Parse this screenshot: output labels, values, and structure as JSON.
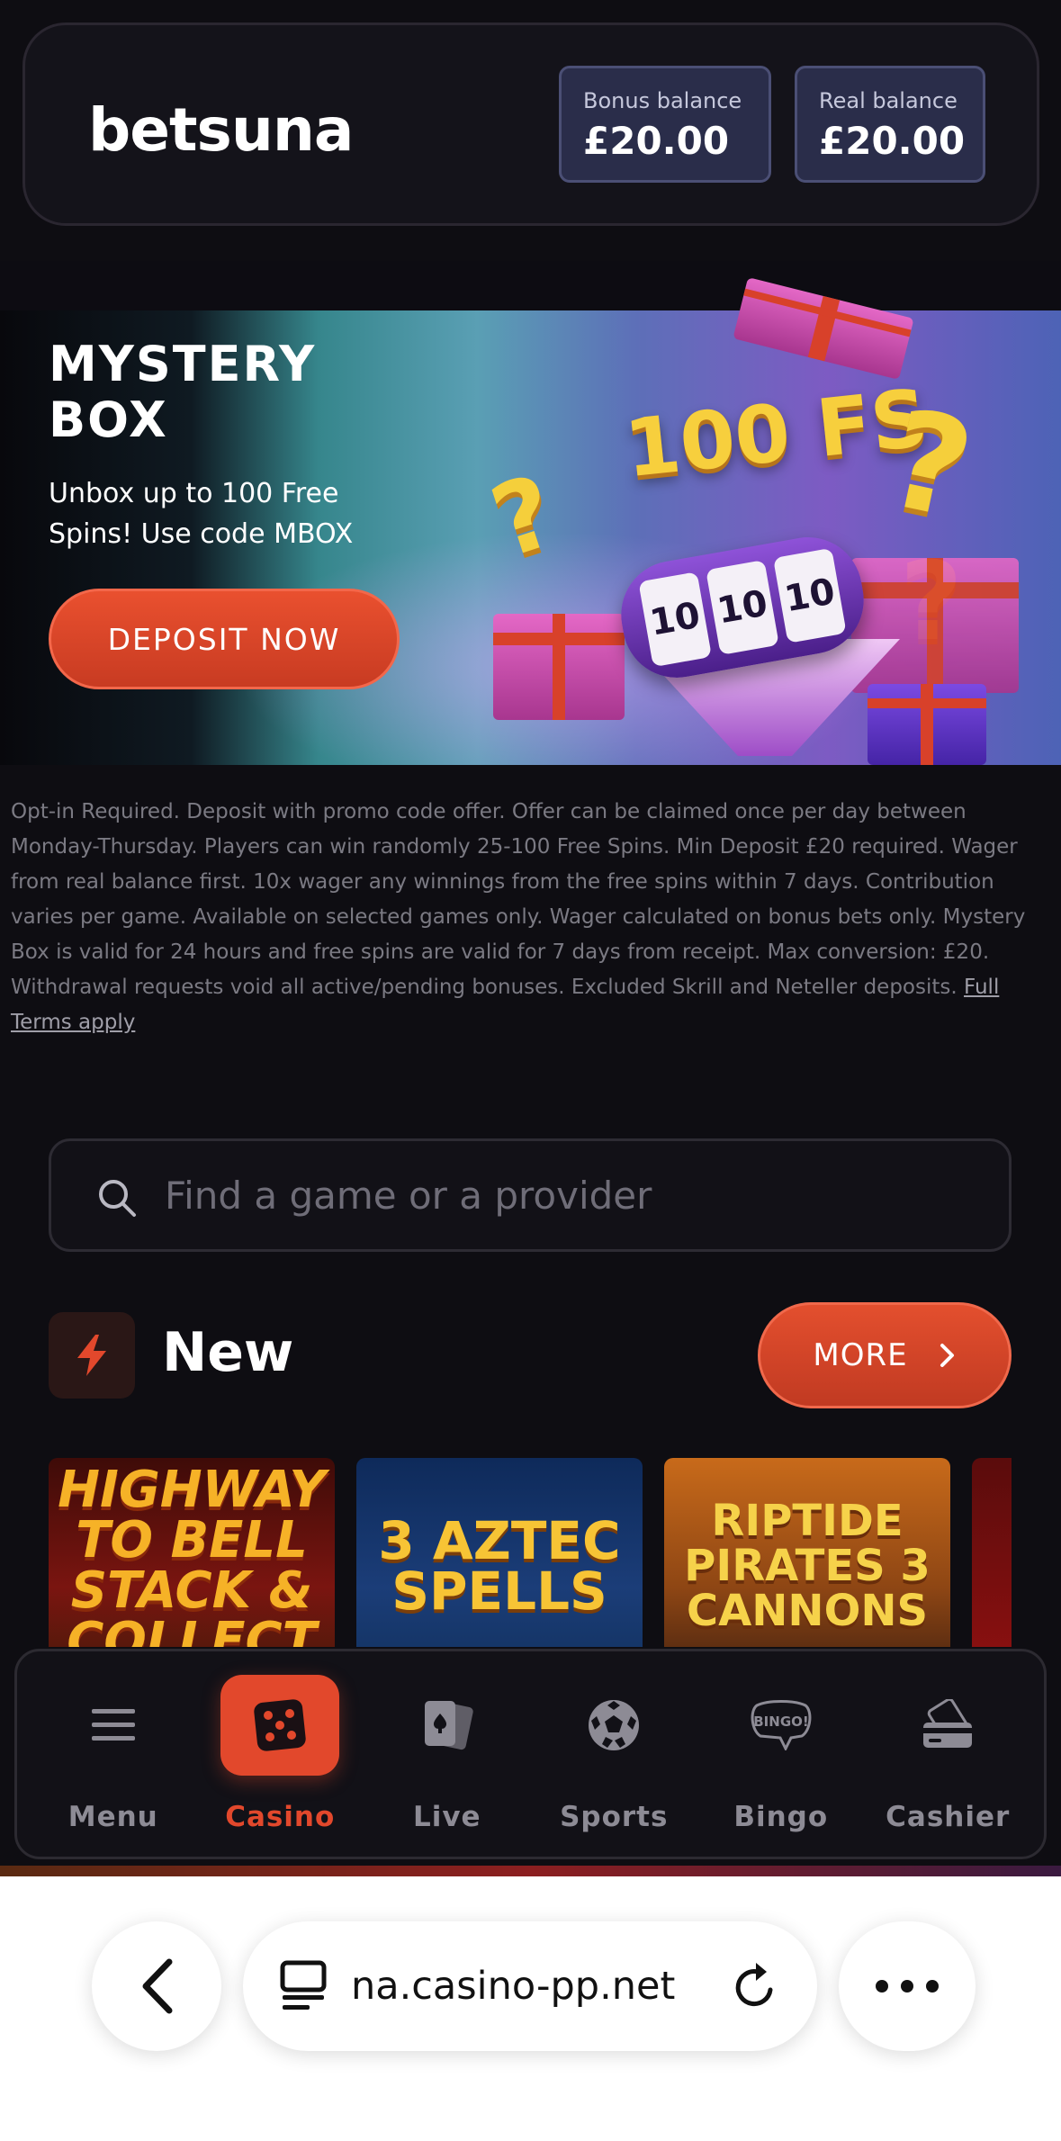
{
  "header": {
    "logo": "betsuna",
    "bonus_balance": {
      "label": "Bonus balance",
      "amount": "£20.00"
    },
    "real_balance": {
      "label": "Real balance",
      "amount": "£20.00"
    }
  },
  "promo": {
    "title": "MYSTERY\nBOX",
    "subtitle": "Unbox up to 100 Free Spins! Use code MBOX",
    "cta": "DEPOSIT NOW",
    "art_text": "100 FS",
    "reels": [
      "10",
      "10",
      "10"
    ],
    "terms": "Opt-in Required. Deposit with promo code offer. Offer can be claimed once per day between Monday-Thursday. Players can win randomly 25-100 Free Spins. Min Deposit £20 required. Wager from real balance first. 10x wager any winnings from the free spins within 7 days. Contribution varies per game. Available on selected games only. Wager calculated on bonus bets only. Mystery Box is valid for 24 hours and free spins are valid for 7 days from receipt. Max conversion: £20. Withdrawal requests void all active/pending bonuses. Excluded Skrill and Neteller deposits.",
    "terms_link": "Full Terms apply"
  },
  "search": {
    "placeholder": "Find a game or a provider",
    "icon": "search-icon"
  },
  "new_section": {
    "title": "New",
    "more_label": "MORE",
    "games": [
      {
        "title": "HIGHWAY TO BELL STACK & COLLECT"
      },
      {
        "title": "3 AZTEC SPELLS"
      },
      {
        "title": "RIPTIDE PIRATES 3 CANNONS"
      }
    ]
  },
  "bottom_nav": {
    "active": "Casino",
    "items": [
      {
        "label": "Menu",
        "icon": "menu-icon"
      },
      {
        "label": "Casino",
        "icon": "dice-icon"
      },
      {
        "label": "Live",
        "icon": "cards-icon"
      },
      {
        "label": "Sports",
        "icon": "football-icon"
      },
      {
        "label": "Bingo",
        "icon": "bingo-icon"
      },
      {
        "label": "Cashier",
        "icon": "cashier-icon"
      }
    ]
  },
  "browser": {
    "url": "na.casino-pp.net"
  },
  "colors": {
    "accent": "#e2482c",
    "background": "#0e0d12",
    "balance_box": "#2a2d4a"
  }
}
